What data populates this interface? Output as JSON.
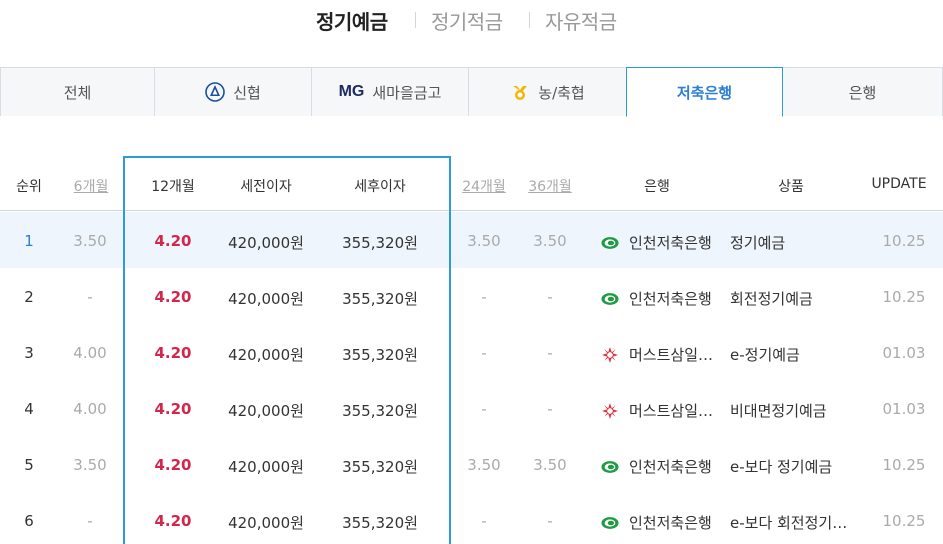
{
  "top_tabs": [
    {
      "label": "정기예금",
      "active": true
    },
    {
      "label": "정기적금",
      "active": false
    },
    {
      "label": "자유적금",
      "active": false
    }
  ],
  "categories": [
    {
      "label": "전체",
      "icon": ""
    },
    {
      "label": "신협",
      "icon": "shinhyup-logo-icon"
    },
    {
      "label": "새마을금고",
      "icon": "mg-logo-icon",
      "logo_text": "MG"
    },
    {
      "label": "농/축협",
      "icon": "nonghyup-logo-icon"
    },
    {
      "label": "저축은행",
      "icon": "",
      "active": true
    },
    {
      "label": "은행",
      "icon": ""
    }
  ],
  "table": {
    "headers": {
      "rank": "순위",
      "m6": "6개월",
      "m12": "12개월",
      "pretax": "세전이자",
      "posttax": "세후이자",
      "m24": "24개월",
      "m36": "36개월",
      "bank": "은행",
      "product": "상품",
      "update": "UPDATE"
    },
    "rows": [
      {
        "rank": "1",
        "m6": "3.50",
        "m12": "4.20",
        "pretax": "420,000원",
        "posttax": "355,320원",
        "m24": "3.50",
        "m36": "3.50",
        "bank": "인천저축은행",
        "bank_icon": "incheon-bank-logo-icon",
        "product": "정기예금",
        "update": "10.25"
      },
      {
        "rank": "2",
        "m6": "-",
        "m12": "4.20",
        "pretax": "420,000원",
        "posttax": "355,320원",
        "m24": "-",
        "m36": "-",
        "bank": "인천저축은행",
        "bank_icon": "incheon-bank-logo-icon",
        "product": "회전정기예금",
        "update": "10.25"
      },
      {
        "rank": "3",
        "m6": "4.00",
        "m12": "4.20",
        "pretax": "420,000원",
        "posttax": "355,320원",
        "m24": "-",
        "m36": "-",
        "bank": "머스트삼일…",
        "bank_icon": "mustsamil-logo-icon",
        "product": "e-정기예금",
        "update": "01.03"
      },
      {
        "rank": "4",
        "m6": "4.00",
        "m12": "4.20",
        "pretax": "420,000원",
        "posttax": "355,320원",
        "m24": "-",
        "m36": "-",
        "bank": "머스트삼일…",
        "bank_icon": "mustsamil-logo-icon",
        "product": "비대면정기예금",
        "update": "01.03"
      },
      {
        "rank": "5",
        "m6": "3.50",
        "m12": "4.20",
        "pretax": "420,000원",
        "posttax": "355,320원",
        "m24": "3.50",
        "m36": "3.50",
        "bank": "인천저축은행",
        "bank_icon": "incheon-bank-logo-icon",
        "product": "e-보다 정기예금",
        "update": "10.25"
      },
      {
        "rank": "6",
        "m6": "-",
        "m12": "4.20",
        "pretax": "420,000원",
        "posttax": "355,320원",
        "m24": "-",
        "m36": "-",
        "bank": "인천저축은행",
        "bank_icon": "incheon-bank-logo-icon",
        "product": "e-보다 회전정기…",
        "update": "10.25"
      }
    ]
  },
  "colors": {
    "accent_blue": "#2f9ad9",
    "rate_red": "#d2264b",
    "highlight_row": "#eef5fc"
  }
}
